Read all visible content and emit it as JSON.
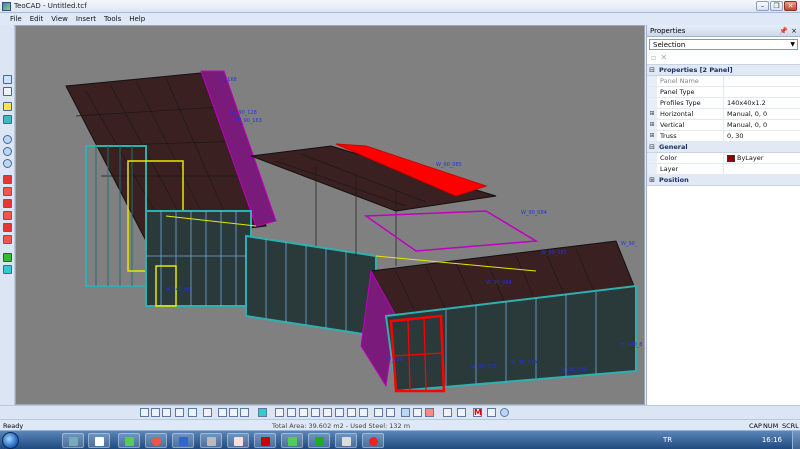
{
  "window": {
    "title": "TeoCAD - Untitled.tcf",
    "minimize_glyph": "–",
    "restore_glyph": "❐",
    "close_glyph": "✕"
  },
  "menu": [
    "File",
    "Edit",
    "View",
    "Insert",
    "Tools",
    "Help"
  ],
  "properties": {
    "header": "Properties",
    "pin_glyph": "📌",
    "close_glyph": "×",
    "selection": "Selection",
    "category_main": "Properties [2 Panel]",
    "rows": [
      {
        "key": "Panel Name",
        "value": "",
        "dim": true
      },
      {
        "key": "Panel Type",
        "value": ""
      },
      {
        "key": "Profiles Type",
        "value": "140x40x1.2"
      },
      {
        "key": "Horizontal",
        "value": "Manual, 0, 0",
        "expandable": true
      },
      {
        "key": "Vertical",
        "value": "Manual, 0, 0",
        "expandable": true
      },
      {
        "key": "Truss",
        "value": "0, 30",
        "expandable": true
      }
    ],
    "category_general": "General",
    "general_rows": [
      {
        "key": "Color",
        "value": "ByLayer",
        "swatch": "#8b0000"
      },
      {
        "key": "Layer",
        "value": ""
      }
    ],
    "category_position": "Position",
    "expand_glyph": "⊞",
    "collapse_glyph": "⊟"
  },
  "canvas_labels": [
    "H_168",
    "W_90_128",
    "W_90_163",
    "W_90_085",
    "W_90_084",
    "W_90_",
    "W_90_085",
    "H_140_80",
    "W_90_084",
    "H_140_8",
    "W_029",
    "W_90_028",
    "W_90_039",
    "W_90_039"
  ],
  "status": {
    "ready": "Ready",
    "info": "Total Area: 39.602 m2 - Used Steel: 132 m",
    "cap": "CAP",
    "num": "NUM",
    "scrl": "SCRL"
  },
  "taskbar": {
    "lang": "TR",
    "time": "16:16"
  },
  "colors": {
    "canvas_bg": "#808080",
    "roof_red": "#ff0000",
    "frame_teal": "#2fb0b0",
    "frame_magenta": "#c000c0",
    "frame_yellow": "#e8e800"
  }
}
